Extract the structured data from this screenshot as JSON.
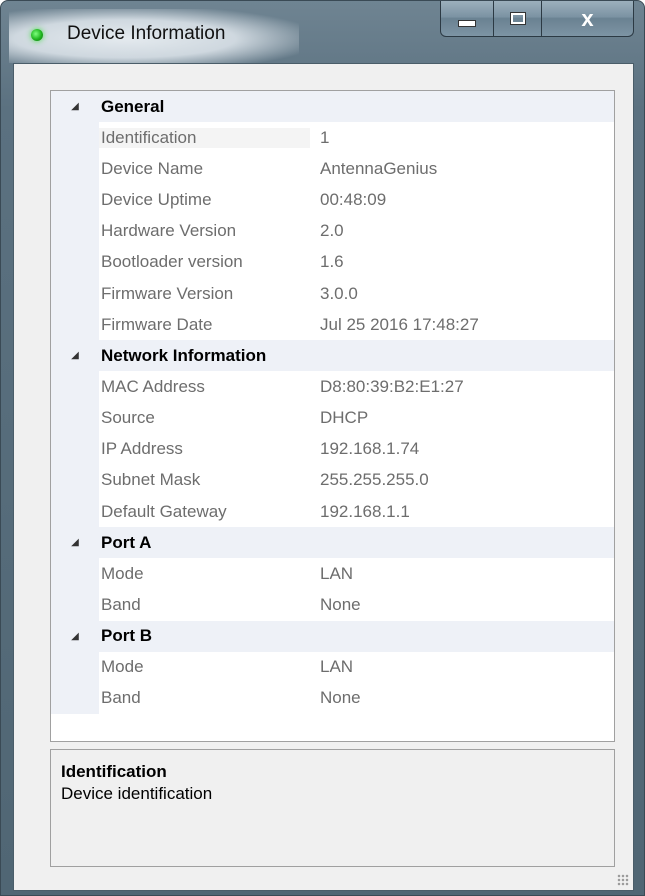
{
  "window": {
    "title": "Device Information"
  },
  "caption": {
    "close_glyph": "x"
  },
  "categories": [
    {
      "label": "General",
      "properties": [
        {
          "name": "Identification",
          "value": "1"
        },
        {
          "name": "Device Name",
          "value": "AntennaGenius"
        },
        {
          "name": "Device Uptime",
          "value": "00:48:09"
        },
        {
          "name": "Hardware Version",
          "value": "2.0"
        },
        {
          "name": "Bootloader version",
          "value": "1.6"
        },
        {
          "name": "Firmware Version",
          "value": "3.0.0"
        },
        {
          "name": "Firmware Date",
          "value": "Jul 25 2016 17:48:27"
        }
      ]
    },
    {
      "label": "Network Information",
      "properties": [
        {
          "name": "MAC Address",
          "value": "D8:80:39:B2:E1:27"
        },
        {
          "name": "Source",
          "value": "DHCP"
        },
        {
          "name": "IP Address",
          "value": "192.168.1.74"
        },
        {
          "name": "Subnet Mask",
          "value": "255.255.255.0"
        },
        {
          "name": "Default Gateway",
          "value": "192.168.1.1"
        }
      ]
    },
    {
      "label": "Port A",
      "properties": [
        {
          "name": "Mode",
          "value": "LAN"
        },
        {
          "name": "Band",
          "value": "None"
        }
      ]
    },
    {
      "label": "Port B",
      "properties": [
        {
          "name": "Mode",
          "value": "LAN"
        },
        {
          "name": "Band",
          "value": "None"
        }
      ]
    }
  ],
  "description": {
    "title": "Identification",
    "text": "Device identification"
  }
}
